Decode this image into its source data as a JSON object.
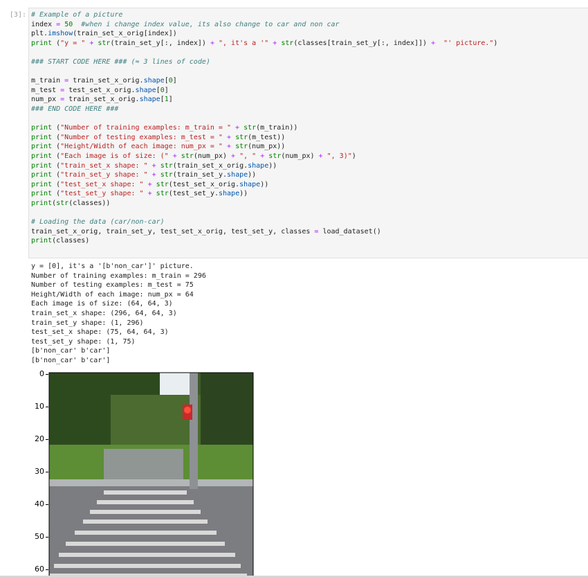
{
  "cell": {
    "prompt": "[3]:",
    "code_lines": [
      [
        {
          "t": "# Example of a picture",
          "c": "cm"
        }
      ],
      [
        {
          "t": "index ",
          "c": ""
        },
        {
          "t": "=",
          "c": "op"
        },
        {
          "t": " ",
          "c": ""
        },
        {
          "t": "50",
          "c": "nu"
        },
        {
          "t": "  ",
          "c": ""
        },
        {
          "t": "#when i change index value, its also change to car and non car",
          "c": "cm"
        }
      ],
      [
        {
          "t": "plt.",
          "c": ""
        },
        {
          "t": "imshow",
          "c": "at"
        },
        {
          "t": "(train_set_x_orig[index])",
          "c": ""
        }
      ],
      [
        {
          "t": "print",
          "c": "kw"
        },
        {
          "t": " (",
          "c": ""
        },
        {
          "t": "\"y = \"",
          "c": "st"
        },
        {
          "t": " ",
          "c": ""
        },
        {
          "t": "+",
          "c": "op"
        },
        {
          "t": " ",
          "c": ""
        },
        {
          "t": "str",
          "c": "bi"
        },
        {
          "t": "(train_set_y[:, index]) ",
          "c": ""
        },
        {
          "t": "+",
          "c": "op"
        },
        {
          "t": " ",
          "c": ""
        },
        {
          "t": "\", it's a '\"",
          "c": "st"
        },
        {
          "t": " ",
          "c": ""
        },
        {
          "t": "+",
          "c": "op"
        },
        {
          "t": " ",
          "c": ""
        },
        {
          "t": "str",
          "c": "bi"
        },
        {
          "t": "(classes[train_set_y[:, index]]) ",
          "c": ""
        },
        {
          "t": "+",
          "c": "op"
        },
        {
          "t": "  ",
          "c": ""
        },
        {
          "t": "\"' picture.\"",
          "c": "st"
        },
        {
          "t": ")",
          "c": ""
        }
      ],
      [],
      [
        {
          "t": "### START CODE HERE ### (≈ 3 lines of code)",
          "c": "cm"
        }
      ],
      [],
      [
        {
          "t": "m_train ",
          "c": ""
        },
        {
          "t": "=",
          "c": "op"
        },
        {
          "t": " train_set_x_orig.",
          "c": ""
        },
        {
          "t": "shape",
          "c": "at"
        },
        {
          "t": "[",
          "c": ""
        },
        {
          "t": "0",
          "c": "nu"
        },
        {
          "t": "]",
          "c": ""
        }
      ],
      [
        {
          "t": "m_test ",
          "c": ""
        },
        {
          "t": "=",
          "c": "op"
        },
        {
          "t": " test_set_x_orig.",
          "c": ""
        },
        {
          "t": "shape",
          "c": "at"
        },
        {
          "t": "[",
          "c": ""
        },
        {
          "t": "0",
          "c": "nu"
        },
        {
          "t": "]",
          "c": ""
        }
      ],
      [
        {
          "t": "num_px ",
          "c": ""
        },
        {
          "t": "=",
          "c": "op"
        },
        {
          "t": " train_set_x_orig.",
          "c": ""
        },
        {
          "t": "shape",
          "c": "at"
        },
        {
          "t": "[",
          "c": ""
        },
        {
          "t": "1",
          "c": "nu"
        },
        {
          "t": "]",
          "c": ""
        }
      ],
      [
        {
          "t": "### END CODE HERE ###",
          "c": "cm"
        }
      ],
      [],
      [
        {
          "t": "print",
          "c": "kw"
        },
        {
          "t": " (",
          "c": ""
        },
        {
          "t": "\"Number of training examples: m_train = \"",
          "c": "st"
        },
        {
          "t": " ",
          "c": ""
        },
        {
          "t": "+",
          "c": "op"
        },
        {
          "t": " ",
          "c": ""
        },
        {
          "t": "str",
          "c": "bi"
        },
        {
          "t": "(m_train))",
          "c": ""
        }
      ],
      [
        {
          "t": "print",
          "c": "kw"
        },
        {
          "t": " (",
          "c": ""
        },
        {
          "t": "\"Number of testing examples: m_test = \"",
          "c": "st"
        },
        {
          "t": " ",
          "c": ""
        },
        {
          "t": "+",
          "c": "op"
        },
        {
          "t": " ",
          "c": ""
        },
        {
          "t": "str",
          "c": "bi"
        },
        {
          "t": "(m_test))",
          "c": ""
        }
      ],
      [
        {
          "t": "print",
          "c": "kw"
        },
        {
          "t": " (",
          "c": ""
        },
        {
          "t": "\"Height/Width of each image: num_px = \"",
          "c": "st"
        },
        {
          "t": " ",
          "c": ""
        },
        {
          "t": "+",
          "c": "op"
        },
        {
          "t": " ",
          "c": ""
        },
        {
          "t": "str",
          "c": "bi"
        },
        {
          "t": "(num_px))",
          "c": ""
        }
      ],
      [
        {
          "t": "print",
          "c": "kw"
        },
        {
          "t": " (",
          "c": ""
        },
        {
          "t": "\"Each image is of size: (\"",
          "c": "st"
        },
        {
          "t": " ",
          "c": ""
        },
        {
          "t": "+",
          "c": "op"
        },
        {
          "t": " ",
          "c": ""
        },
        {
          "t": "str",
          "c": "bi"
        },
        {
          "t": "(num_px) ",
          "c": ""
        },
        {
          "t": "+",
          "c": "op"
        },
        {
          "t": " ",
          "c": ""
        },
        {
          "t": "\", \"",
          "c": "st"
        },
        {
          "t": " ",
          "c": ""
        },
        {
          "t": "+",
          "c": "op"
        },
        {
          "t": " ",
          "c": ""
        },
        {
          "t": "str",
          "c": "bi"
        },
        {
          "t": "(num_px) ",
          "c": ""
        },
        {
          "t": "+",
          "c": "op"
        },
        {
          "t": " ",
          "c": ""
        },
        {
          "t": "\", 3)\"",
          "c": "st"
        },
        {
          "t": ")",
          "c": ""
        }
      ],
      [
        {
          "t": "print",
          "c": "kw"
        },
        {
          "t": " (",
          "c": ""
        },
        {
          "t": "\"train_set_x shape: \"",
          "c": "st"
        },
        {
          "t": " ",
          "c": ""
        },
        {
          "t": "+",
          "c": "op"
        },
        {
          "t": " ",
          "c": ""
        },
        {
          "t": "str",
          "c": "bi"
        },
        {
          "t": "(train_set_x_orig.",
          "c": ""
        },
        {
          "t": "shape",
          "c": "at"
        },
        {
          "t": "))",
          "c": ""
        }
      ],
      [
        {
          "t": "print",
          "c": "kw"
        },
        {
          "t": " (",
          "c": ""
        },
        {
          "t": "\"train_set_y shape: \"",
          "c": "st"
        },
        {
          "t": " ",
          "c": ""
        },
        {
          "t": "+",
          "c": "op"
        },
        {
          "t": " ",
          "c": ""
        },
        {
          "t": "str",
          "c": "bi"
        },
        {
          "t": "(train_set_y.",
          "c": ""
        },
        {
          "t": "shape",
          "c": "at"
        },
        {
          "t": "))",
          "c": ""
        }
      ],
      [
        {
          "t": "print",
          "c": "kw"
        },
        {
          "t": " (",
          "c": ""
        },
        {
          "t": "\"test_set_x shape: \"",
          "c": "st"
        },
        {
          "t": " ",
          "c": ""
        },
        {
          "t": "+",
          "c": "op"
        },
        {
          "t": " ",
          "c": ""
        },
        {
          "t": "str",
          "c": "bi"
        },
        {
          "t": "(test_set_x_orig.",
          "c": ""
        },
        {
          "t": "shape",
          "c": "at"
        },
        {
          "t": "))",
          "c": ""
        }
      ],
      [
        {
          "t": "print",
          "c": "kw"
        },
        {
          "t": " (",
          "c": ""
        },
        {
          "t": "\"test_set_y shape: \"",
          "c": "st"
        },
        {
          "t": " ",
          "c": ""
        },
        {
          "t": "+",
          "c": "op"
        },
        {
          "t": " ",
          "c": ""
        },
        {
          "t": "str",
          "c": "bi"
        },
        {
          "t": "(test_set_y.",
          "c": ""
        },
        {
          "t": "shape",
          "c": "at"
        },
        {
          "t": "))",
          "c": ""
        }
      ],
      [
        {
          "t": "print",
          "c": "kw"
        },
        {
          "t": "(",
          "c": ""
        },
        {
          "t": "str",
          "c": "bi"
        },
        {
          "t": "(classes))",
          "c": ""
        }
      ],
      [],
      [
        {
          "t": "# Loading the data (car/non-car)",
          "c": "cm"
        }
      ],
      [
        {
          "t": "train_set_x_orig, train_set_y, test_set_x_orig, test_set_y, classes ",
          "c": ""
        },
        {
          "t": "=",
          "c": "op"
        },
        {
          "t": " load_dataset()",
          "c": ""
        }
      ],
      [
        {
          "t": "print",
          "c": "kw"
        },
        {
          "t": "(classes)",
          "c": ""
        }
      ]
    ]
  },
  "output": {
    "lines": [
      "y = [0], it's a '[b'non_car']' picture.",
      "Number of training examples: m_train = 296",
      "Number of testing examples: m_test = 75",
      "Height/Width of each image: num_px = 64",
      "Each image is of size: (64, 64, 3)",
      "train_set_x shape: (296, 64, 64, 3)",
      "train_set_y shape: (1, 296)",
      "test_set_x shape: (75, 64, 64, 3)",
      "test_set_y shape: (1, 75)",
      "[b'non_car' b'car']",
      "[b'non_car' b'car']"
    ]
  },
  "figure": {
    "yticks": [
      "0",
      "10",
      "20",
      "30",
      "40",
      "50",
      "60"
    ],
    "colors": {
      "sky": "#e8eef2",
      "trees_dark": "#2f4a22",
      "trees_mid": "#4b6b30",
      "grass": "#5a8a33",
      "road": "#7d7f82",
      "stripe": "#d9d9d9",
      "pole": "#8b8f92",
      "signal": "#d0282a"
    }
  }
}
